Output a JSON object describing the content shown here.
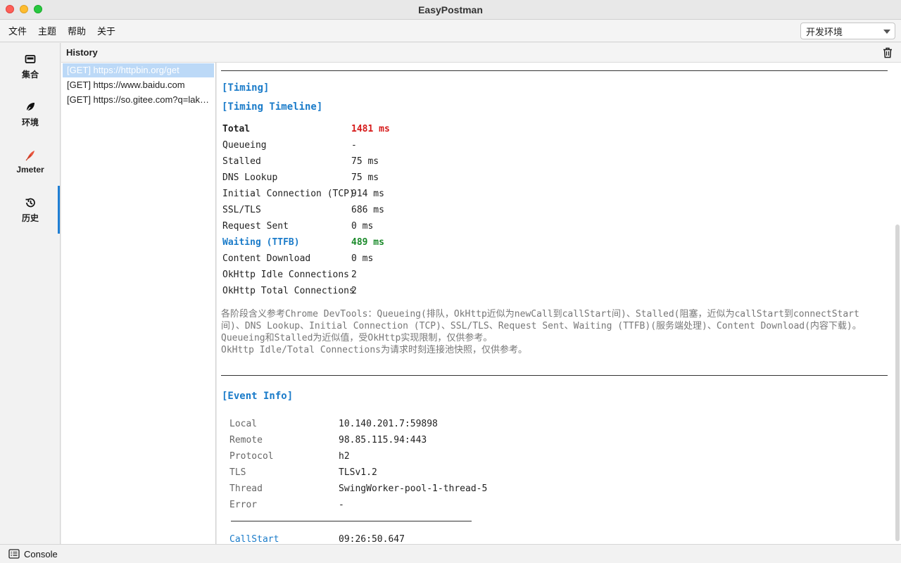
{
  "window": {
    "title": "EasyPostman"
  },
  "menu": {
    "items": [
      "文件",
      "主题",
      "帮助",
      "关于"
    ]
  },
  "env_select": {
    "value": "开发环境"
  },
  "nav": {
    "items": [
      {
        "label": "集合",
        "icon": "collection-icon"
      },
      {
        "label": "环境",
        "icon": "leaf-icon"
      },
      {
        "label": "Jmeter",
        "icon": "feather-icon"
      },
      {
        "label": "历史",
        "icon": "history-icon"
      }
    ],
    "active": "历史"
  },
  "history": {
    "title": "History",
    "items": [
      "[GET] https://httpbin.org/get",
      "[GET] https://www.baidu.com",
      "[GET] https://so.gitee.com?q=laker..."
    ],
    "selected_index": 0
  },
  "timing": {
    "section1": "[Timing]",
    "section2": "[Timing Timeline]",
    "rows": [
      {
        "key": "Total",
        "value": "1481 ms"
      },
      {
        "key": "Queueing",
        "value": "-"
      },
      {
        "key": "Stalled",
        "value": "75 ms"
      },
      {
        "key": "DNS Lookup",
        "value": "75 ms"
      },
      {
        "key": "Initial Connection (TCP)",
        "value": "914 ms"
      },
      {
        "key": "SSL/TLS",
        "value": "686 ms"
      },
      {
        "key": "Request Sent",
        "value": "0 ms"
      },
      {
        "key": "Waiting (TTFB)",
        "value": "489 ms"
      },
      {
        "key": "Content Download",
        "value": "0 ms"
      },
      {
        "key": "OkHttp Idle Connections",
        "value": "2"
      },
      {
        "key": "OkHttp Total Connections",
        "value": "2"
      }
    ],
    "note_lines": [
      "各阶段含义参考Chrome DevTools：Queueing(排队，OkHttp近似为newCall到callStart间)、Stalled(阻塞，近似为callStart到connectStart",
      "间)、DNS Lookup、Initial Connection (TCP)、SSL/TLS、Request Sent、Waiting (TTFB)(服务端处理)、Content Download(内容下载)。",
      "Queueing和Stalled为近似值，受OkHttp实现限制，仅供参考。",
      "OkHttp Idle/Total Connections为请求时刻连接池快照，仅供参考。"
    ]
  },
  "event": {
    "section": "[Event Info]",
    "rows": [
      {
        "key": "Local",
        "value": "10.140.201.7:59898"
      },
      {
        "key": "Remote",
        "value": "98.85.115.94:443"
      },
      {
        "key": "Protocol",
        "value": "h2"
      },
      {
        "key": "TLS",
        "value": "TLSv1.2"
      },
      {
        "key": "Thread",
        "value": "SwingWorker-pool-1-thread-5"
      },
      {
        "key": "Error",
        "value": "-"
      }
    ],
    "callstart": {
      "key": "CallStart",
      "value": "09:26:50.647"
    }
  },
  "statusbar": {
    "console": "Console"
  }
}
